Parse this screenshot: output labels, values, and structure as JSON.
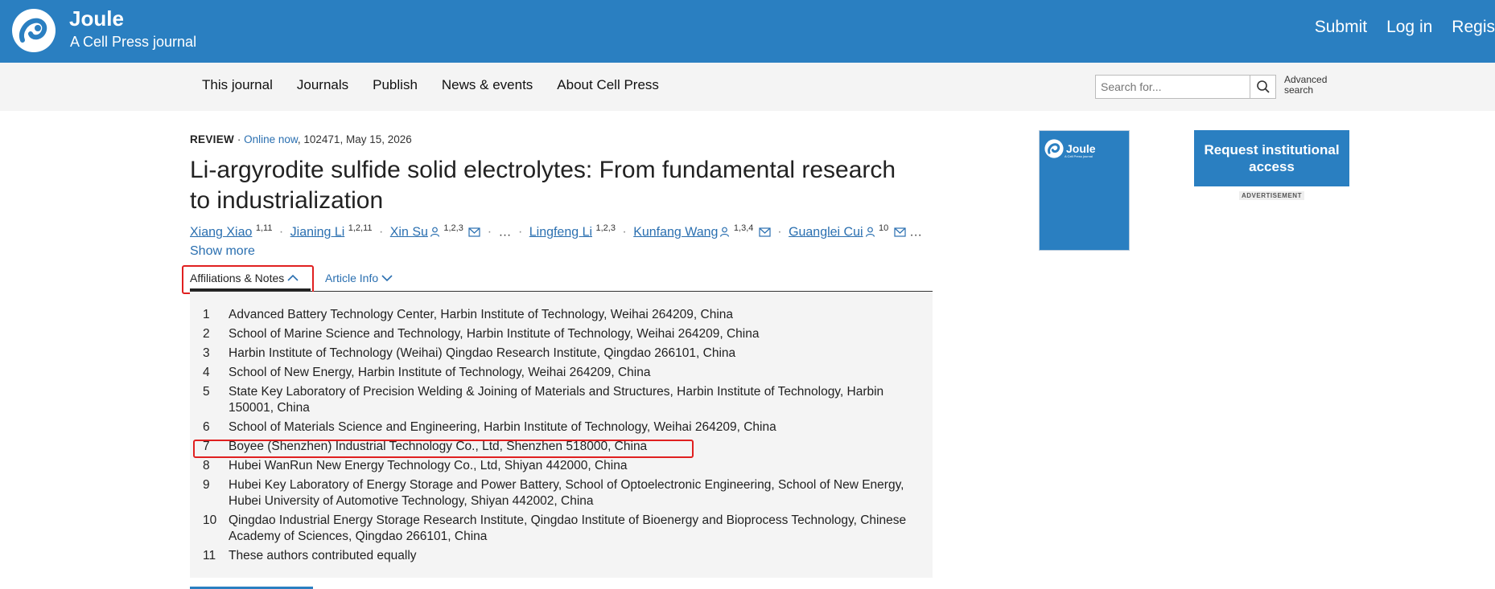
{
  "header": {
    "brand_name": "Joule",
    "brand_sub": "A Cell Press journal",
    "links": [
      "Submit",
      "Log in",
      "Regis"
    ]
  },
  "nav": {
    "items": [
      "This journal",
      "Journals",
      "Publish",
      "News & events",
      "About Cell Press"
    ],
    "search_placeholder": "Search for...",
    "advanced": "Advanced search"
  },
  "article": {
    "type": "REVIEW",
    "online": "Online now",
    "meta_rest": ", 102471, May 15, 2026",
    "title": "Li-argyrodite sulfide solid electrolytes: From fundamental research to industrialization",
    "authors": [
      {
        "name": "Xiang Xiao",
        "sup": "1,11"
      },
      {
        "name": "Jianing Li",
        "sup": "1,2,11"
      },
      {
        "name": "Xin Su",
        "sup": "1,2,3"
      },
      {
        "name": "Lingfeng Li",
        "sup": "1,2,3"
      },
      {
        "name": "Kunfang Wang",
        "sup": "1,3,4"
      },
      {
        "name": "Guanglei Cui",
        "sup": "10"
      }
    ],
    "separator": "·",
    "ellipsis": "…",
    "show_more": "Show more"
  },
  "tabs": {
    "affiliations": "Affiliations & Notes",
    "article_info": "Article Info"
  },
  "affiliations": [
    {
      "num": "1",
      "text": "Advanced Battery Technology Center, Harbin Institute of Technology, Weihai 264209, China"
    },
    {
      "num": "2",
      "text": "School of Marine Science and Technology, Harbin Institute of Technology, Weihai 264209, China"
    },
    {
      "num": "3",
      "text": "Harbin Institute of Technology (Weihai) Qingdao Research Institute, Qingdao 266101, China"
    },
    {
      "num": "4",
      "text": "School of New Energy, Harbin Institute of Technology, Weihai 264209, China"
    },
    {
      "num": "5",
      "text": "State Key Laboratory of Precision Welding & Joining of Materials and Structures, Harbin Institute of Technology, Harbin 150001, China"
    },
    {
      "num": "6",
      "text": "School of Materials Science and Engineering, Harbin Institute of Technology, Weihai 264209, China"
    },
    {
      "num": "7",
      "text": "Boyee (Shenzhen) Industrial Technology Co., Ltd, Shenzhen 518000, China"
    },
    {
      "num": "8",
      "text": "Hubei WanRun New Energy Technology Co., Ltd, Shiyan 442000, China"
    },
    {
      "num": "9",
      "text": "Hubei Key Laboratory of Energy Storage and Power Battery, School of Optoelectronic Engineering, School of New Energy, Hubei University of Automotive Technology, Shiyan 442002, China"
    },
    {
      "num": "10",
      "text": "Qingdao Industrial Energy Storage Research Institute, Qingdao Institute of Bioenergy and Bioprocess Technology, Chinese Academy of Sciences, Qingdao 266101, China"
    },
    {
      "num": "11",
      "text": "These authors contributed equally"
    }
  ],
  "sidebar": {
    "cover_logo": "Joule",
    "cover_sub": "A Cell Press journal",
    "access_button": "Request institutional access",
    "ad_label": "ADVERTISEMENT"
  },
  "colors": {
    "brand": "#2a7fc1",
    "link": "#2a6fb0",
    "highlight": "#e02020"
  }
}
